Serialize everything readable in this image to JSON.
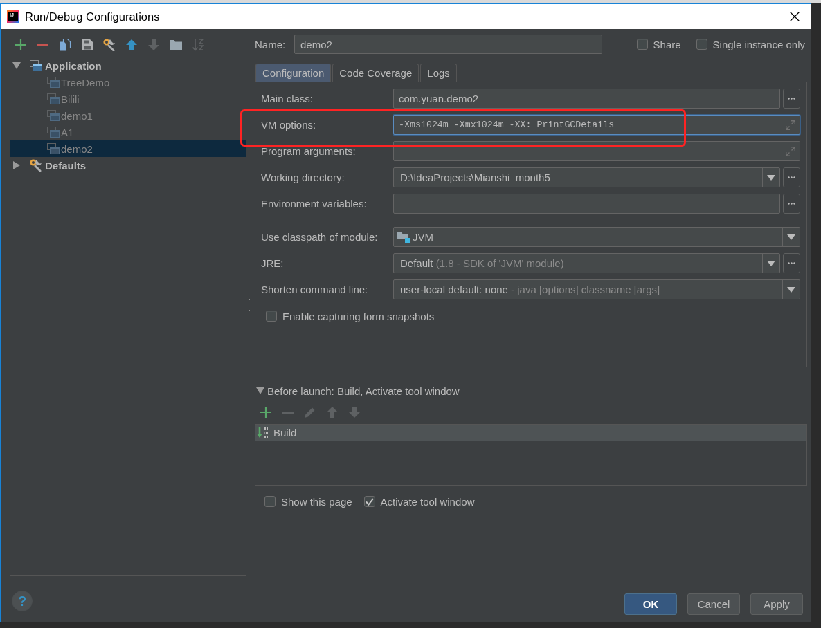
{
  "window": {
    "title": "Run/Debug Configurations",
    "logo_text": "IJ"
  },
  "sidebar": {
    "toolbar": [
      {
        "kind": "add",
        "disabled": false
      },
      {
        "kind": "remove",
        "disabled": false
      },
      {
        "kind": "copy",
        "disabled": false
      },
      {
        "kind": "save",
        "disabled": false
      },
      {
        "kind": "defaults",
        "disabled": false
      },
      {
        "kind": "up",
        "disabled": false
      },
      {
        "kind": "down",
        "disabled": true
      },
      {
        "kind": "folder",
        "disabled": false
      },
      {
        "kind": "sort",
        "disabled": true
      }
    ],
    "tree": [
      {
        "label": "Application",
        "kind": "type",
        "expanded": true,
        "selected": false,
        "children": [
          {
            "label": "TreeDemo",
            "selected": false
          },
          {
            "label": "Bilili",
            "selected": false
          },
          {
            "label": "demo1",
            "selected": false
          },
          {
            "label": "A1",
            "selected": false
          },
          {
            "label": "demo2",
            "selected": true
          }
        ]
      },
      {
        "label": "Defaults",
        "kind": "defaults",
        "expanded": false,
        "selected": false
      }
    ]
  },
  "name_field": {
    "label": "Name:",
    "value": "demo2"
  },
  "options": [
    {
      "label": "Share",
      "checked": false
    },
    {
      "label": "Single instance only",
      "checked": false
    }
  ],
  "tabs": [
    {
      "label": "Configuration",
      "selected": true
    },
    {
      "label": "Code Coverage",
      "selected": false
    },
    {
      "label": "Logs",
      "selected": false
    }
  ],
  "form": {
    "groups": [
      {
        "rows": [
          {
            "label": "Main class:",
            "kind": "text",
            "value": "com.yuan.demo2",
            "browse": true,
            "focused": false,
            "highlighted": false
          },
          {
            "label": "VM options:",
            "kind": "expandable",
            "value": "-Xms1024m -Xmx1024m -XX:+PrintGCDetails",
            "browse": false,
            "focused": true,
            "highlighted": true
          },
          {
            "label": "Program arguments:",
            "kind": "expandable",
            "browse": false,
            "focused": false,
            "highlighted": false
          },
          {
            "label": "Working directory:",
            "kind": "combo",
            "value": "D:\\IdeaProjects\\Mianshi_month5",
            "browse": true,
            "focused": false,
            "highlighted": false
          },
          {
            "label": "Environment variables:",
            "kind": "text",
            "browse": true,
            "focused": false,
            "highlighted": false
          }
        ]
      },
      {
        "rows": [
          {
            "label": "Use classpath of module:",
            "kind": "module",
            "value": "JVM",
            "browse": false,
            "focused": false,
            "highlighted": false
          },
          {
            "label": "JRE:",
            "kind": "combo",
            "value": "Default",
            "detail": "(1.8 - SDK of 'JVM' module)",
            "browse": true,
            "focused": false,
            "highlighted": false
          },
          {
            "label": "Shorten command line:",
            "kind": "combo",
            "value": "user-local default: none",
            "detail": "- java [options] classname [args]",
            "browse": false,
            "focused": false,
            "highlighted": false
          }
        ]
      }
    ],
    "checkboxes": [
      {
        "label": "Enable capturing form snapshots",
        "checked": false
      }
    ]
  },
  "before_launch": {
    "title": "Before launch: Build, Activate tool window",
    "expanded": true,
    "toolbar": [
      {
        "kind": "add",
        "disabled": false
      },
      {
        "kind": "remove",
        "disabled": true
      },
      {
        "kind": "edit",
        "disabled": true
      },
      {
        "kind": "up",
        "disabled": true
      },
      {
        "kind": "down",
        "disabled": true
      }
    ],
    "tasks": [
      {
        "label": "Build",
        "selected": true
      }
    ]
  },
  "launch_options": [
    {
      "label": "Show this page",
      "checked": false
    },
    {
      "label": "Activate tool window",
      "checked": true
    }
  ],
  "help": "?",
  "buttons": [
    {
      "label": "OK",
      "default": true
    },
    {
      "label": "Cancel",
      "default": false
    },
    {
      "label": "Apply",
      "default": false
    }
  ]
}
